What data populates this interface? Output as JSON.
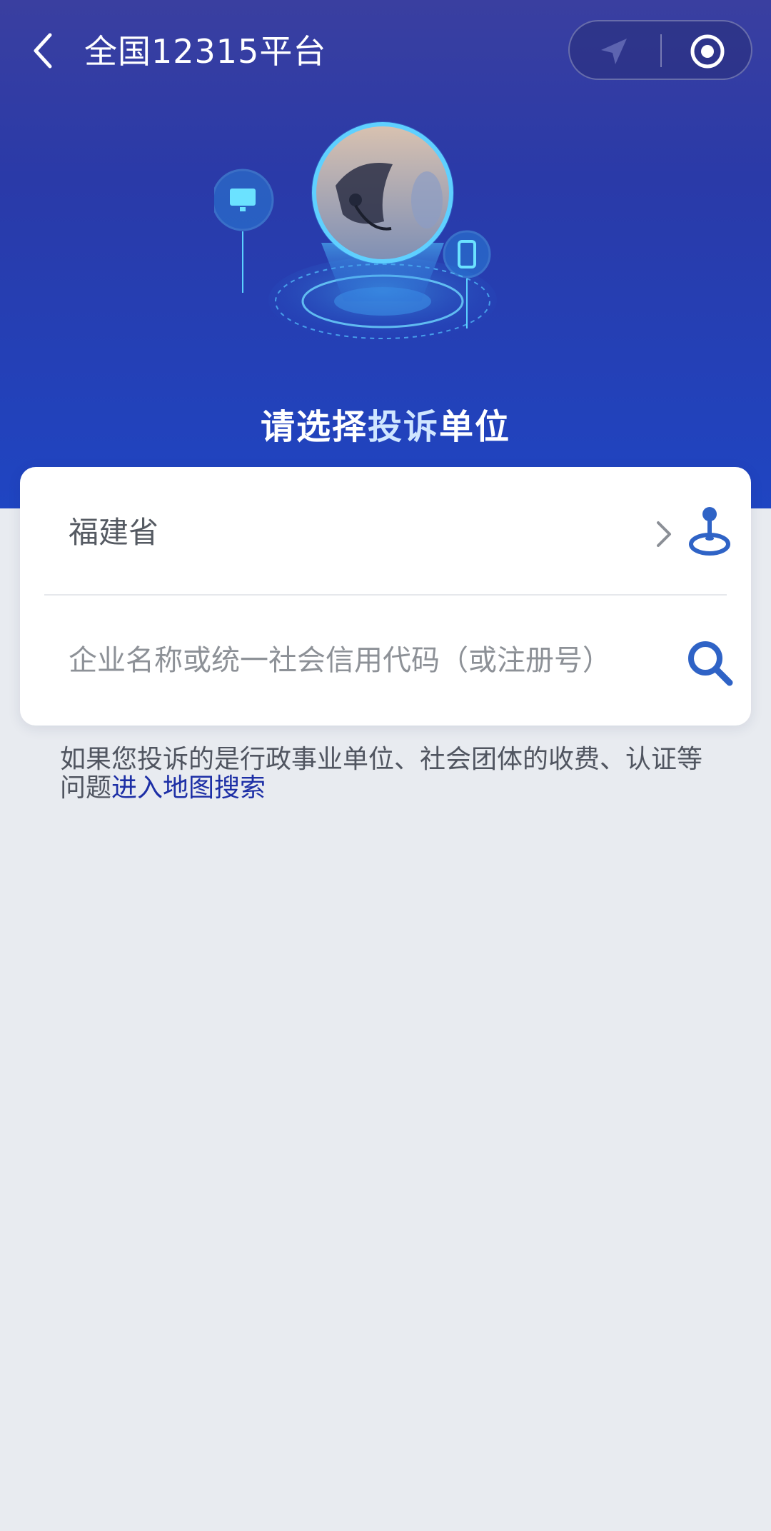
{
  "header": {
    "title": "全国12315平台",
    "back_icon": "chevron-left-icon",
    "location_icon": "navigation-arrow-icon",
    "record_icon": "record-circle-icon"
  },
  "hero": {
    "title_part1": "请选择",
    "title_part2": "投诉",
    "title_part3": "单位",
    "illustration": "customer-service-operator-illustration"
  },
  "form": {
    "province_value": "福建省",
    "search_placeholder": "企业名称或统一社会信用代码（或注册号）"
  },
  "hint": {
    "text": "如果您投诉的是行政事业单位、社会团体的收费、认证等问题",
    "link_label": "进入地图搜索"
  },
  "colors": {
    "hero_top": "#3a3fa0",
    "hero_bottom": "#1f45c2",
    "accent_icon": "#2f63c6",
    "link": "#1d2fa6",
    "page_bg": "#e8ebf0"
  }
}
